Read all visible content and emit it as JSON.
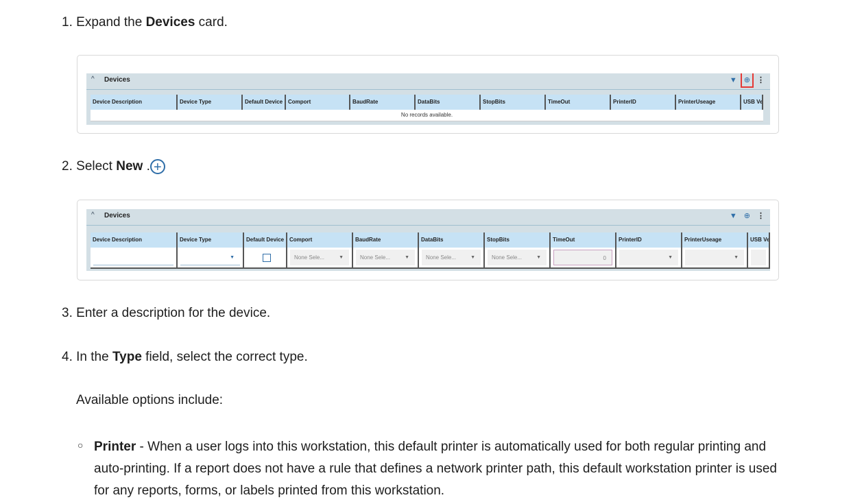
{
  "steps": [
    {
      "num": "1.",
      "pre": "Expand the ",
      "bold": "Devices",
      "post": " card."
    },
    {
      "num": "2.",
      "pre": "Select ",
      "bold": "New",
      "post": " ."
    },
    {
      "num": "3.",
      "text": "Enter a description for the device."
    },
    {
      "num": "4.",
      "pre": "In the ",
      "bold": "Type",
      "post": " field, select the correct type."
    }
  ],
  "available": "Available options include:",
  "option": {
    "bold": "Printer",
    "text": " - When a user logs into this workstation, this default printer is automatically used for both regular printing and auto-printing. If a report does not have a rule that defines a network printer path, this default workstation printer is used for any reports, forms, or labels printed from this workstation."
  },
  "panel": {
    "title": "Devices",
    "chevron": "^",
    "kebab": "⋮"
  },
  "columns": [
    "Device Description",
    "Device Type",
    "Default Device",
    "Comport",
    "BaudRate",
    "DataBits",
    "StopBits",
    "TimeOut",
    "PrinterID",
    "PrinterUseage",
    "USB Ver"
  ],
  "empty_text": "No records available.",
  "new_row": {
    "comport": "None Sele...",
    "baudrate": "None Sele...",
    "databits": "None Sele...",
    "stopbits": "None Sele...",
    "timeout": "0"
  },
  "icons": {
    "filter": "filter-icon",
    "add": "plus-circle-icon",
    "more": "kebab-icon"
  }
}
